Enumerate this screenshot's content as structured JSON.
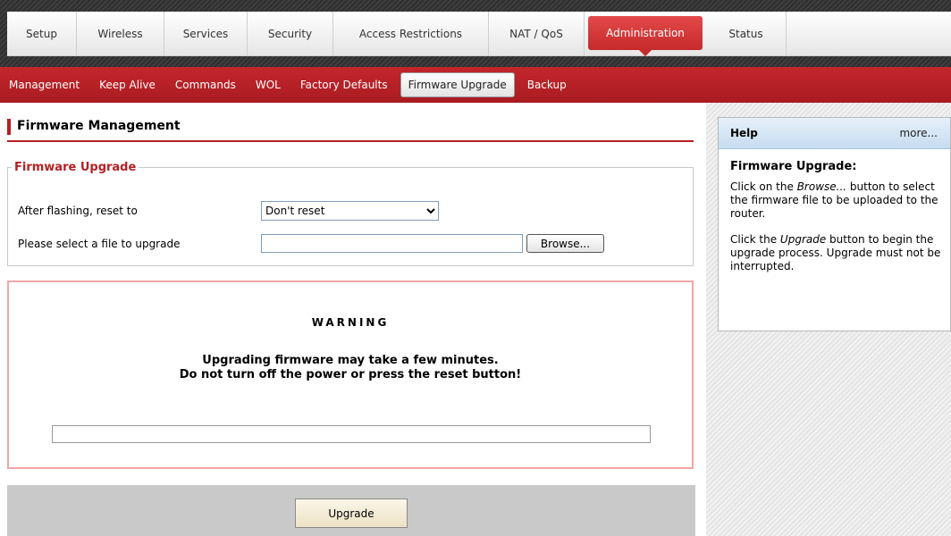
{
  "top_tabs": [
    "Setup",
    "Wireless",
    "Services",
    "Security",
    "Access Restrictions",
    "NAT / QoS",
    "Administration",
    "Status"
  ],
  "active_tab": "Administration",
  "sub_tabs": [
    "Management",
    "Keep Alive",
    "Commands",
    "WOL",
    "Factory Defaults",
    "Firmware Upgrade",
    "Backup"
  ],
  "active_sub_tab": "Firmware Upgrade",
  "page_title": "Firmware Management",
  "firmware_upgrade": {
    "legend": "Firmware Upgrade",
    "reset_label": "After flashing, reset to",
    "reset_value": "Don't reset",
    "file_label": "Please select a file to upgrade",
    "file_value": "",
    "browse_label": "Browse..."
  },
  "warning": {
    "title": "WARNING",
    "line1": "Upgrading firmware may take a few minutes.",
    "line2": "Do not turn off the power or press the reset button!",
    "progress": 0
  },
  "upgrade_button": "Upgrade",
  "help": {
    "header": "Help",
    "more": "more...",
    "title": "Firmware Upgrade:",
    "p1_pre": "Click on the ",
    "p1_em": "Browse...",
    "p1_post": " button to select the firmware file to be uploaded to the router.",
    "p2_pre": "Click the ",
    "p2_em": "Upgrade",
    "p2_post": " button to begin the upgrade process. Upgrade must not be interrupted."
  },
  "colors": {
    "accent": "#b51f23",
    "active_tab": "#d63636",
    "warning_border": "#f0a6a6",
    "action_bar": "#c9c9c9"
  }
}
